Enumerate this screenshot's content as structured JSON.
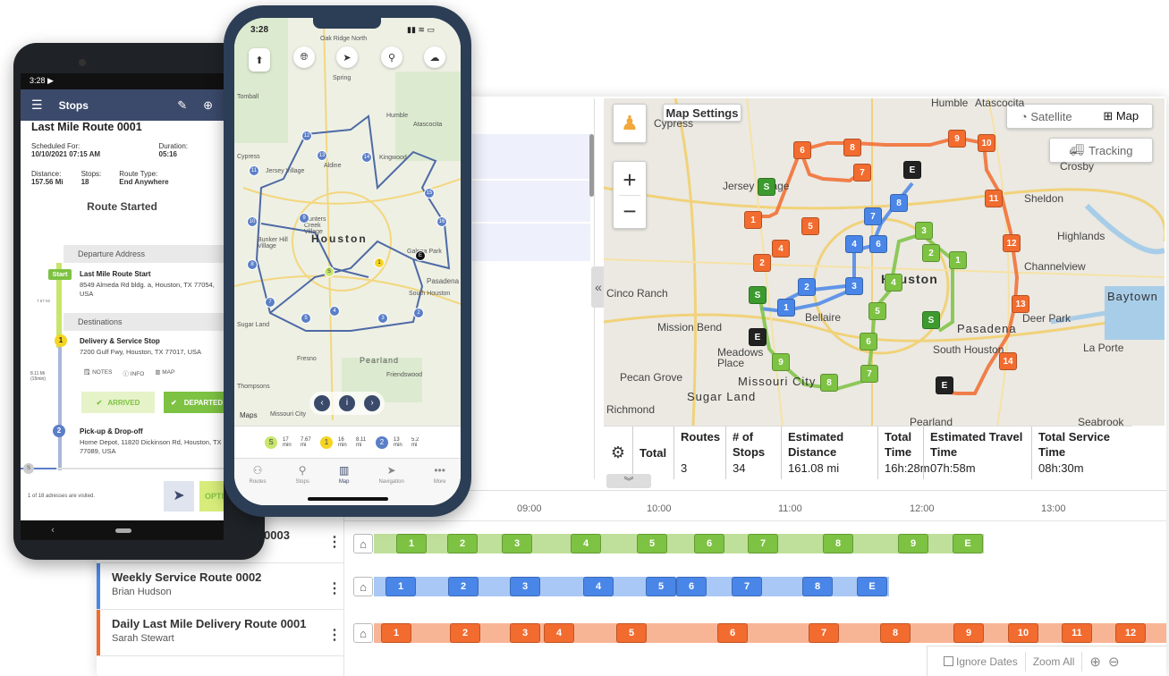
{
  "map": {
    "settings_label": "Map Settings",
    "satellite_label": "Satellite",
    "map_label": "Map",
    "tracking_label": "Tracking",
    "places": [
      "Cypress",
      "Jersey Village",
      "Humble",
      "Atascocita",
      "Crosby",
      "Sheldon",
      "Highlands",
      "Channelview",
      "Baytown",
      "Cinco Ranch",
      "Mission Bend",
      "Bellaire",
      "Houston",
      "Pasadena",
      "Deer Park",
      "La Porte",
      "South Houston",
      "Meadows Place",
      "Pecan Grove",
      "Missouri City",
      "Sugar Land",
      "Richmond",
      "Pearland",
      "Seabrook"
    ],
    "highway_labels": [
      "249",
      "290",
      "10",
      "99",
      "6",
      "90",
      "330",
      "146",
      "610",
      "225",
      "ALT 90",
      "288",
      "8"
    ]
  },
  "summary": {
    "total_label": "Total",
    "headers": [
      "Routes",
      "# of Stops",
      "Estimated Distance",
      "Total Time",
      "Estimated Travel Time",
      "Total Service Time"
    ],
    "values": [
      "3",
      "34",
      "161.08 mi",
      "16h:28m",
      "07h:58m",
      "08h:30m"
    ]
  },
  "timeline": {
    "ticks": [
      "09:00",
      "10:00",
      "11:00",
      "12:00",
      "13:00"
    ],
    "routes": [
      {
        "name": "Weekly Service Route 0002",
        "driver": "Brian Hudson",
        "color": "#4a86e8"
      },
      {
        "name": "Daily Last Mile Delivery Route 0001",
        "driver": "Sarah Stewart",
        "color": "#f26b2f"
      }
    ],
    "route3_partial": "0003",
    "green_stops": [
      "1",
      "2",
      "3",
      "4",
      "5",
      "6",
      "7",
      "8",
      "9",
      "E"
    ],
    "blue_stops": [
      "1",
      "2",
      "3",
      "4",
      "5",
      "6",
      "7",
      "8",
      "E"
    ],
    "orange_stops": [
      "1",
      "2",
      "3",
      "4",
      "5",
      "6",
      "7",
      "8",
      "9",
      "10",
      "11",
      "12"
    ],
    "ignore_dates_label": "Ignore Dates",
    "zoom_all_label": "Zoom All"
  },
  "android": {
    "time": "3:28",
    "header_title": "Stops",
    "route_title": "Last Mile Route 0001",
    "scheduled_label": "Scheduled For:",
    "scheduled_value": "10/10/2021 07:15 AM",
    "duration_label": "Duration:",
    "duration_value": "05:16",
    "distance_label": "Distance:",
    "distance_value": "157.56 Mi",
    "stops_label": "Stops:",
    "stops_value": "18",
    "route_type_label": "Route Type:",
    "route_type_value": "End Anywhere",
    "status": "Route Started",
    "departure_header": "Departure Address",
    "start_badge": "Start",
    "start_name": "Last Mile Route Start",
    "start_address": "8549 Almeda Rd bldg. a, Houston, TX 77054, USA",
    "leg1": "7.57 Mi",
    "destinations_header": "Destinations",
    "stop1_num": "1",
    "stop1_name": "Delivery & Service Stop",
    "stop1_address": "7200 Gulf Fwy, Houston, TX 77017, USA",
    "notes_label": "NOTES",
    "info_label": "INFO",
    "map_label": "MAP",
    "leg2": "8.11 Mi (15min)",
    "arrived_label": "ARRIVED",
    "departed_label": "DEPARTED",
    "stop2_num": "2",
    "stop2_name": "Pick-up & Drop-off",
    "stop2_address": "Home Depot, 11820 Dickinson Rd, Houston, TX 77089, USA",
    "visited_text": "1 of 18 adresses are visited.",
    "optimize_label": "OPTI"
  },
  "iphone": {
    "time": "3:28",
    "city": "Houston",
    "apple_maps": "Maps",
    "labels": [
      "Oak Ridge North",
      "Spring",
      "Humble",
      "Jersey Village",
      "Atascocita",
      "Kingwood",
      "Aldine",
      "Tomball",
      "Cypress",
      "Hunters Creek Village",
      "Bunker Hill Village",
      "Galena Park",
      "South Houston",
      "Pasadena",
      "Pearland",
      "Friendswood",
      "Fresno",
      "Thompsons",
      "Sugar Land",
      "Missouri City"
    ],
    "strip": [
      {
        "badge": "S",
        "min": "17 min",
        "mi": "7.67 mi"
      },
      {
        "badge": "1",
        "min": "16 min",
        "mi": "8.11 mi"
      },
      {
        "badge": "2",
        "min": "13 min",
        "mi": "5.2 mi"
      }
    ],
    "tabs": [
      "Routes",
      "Stops",
      "Map",
      "Navigation",
      "More"
    ]
  }
}
